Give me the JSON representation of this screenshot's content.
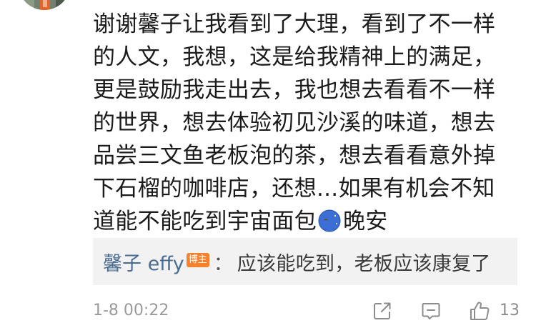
{
  "comment": {
    "lines": [
      "谢谢馨子让我看到了大理，看到了不一样",
      "的人文，我想，这是给我精神上的满足，",
      "更是鼓励我走出去，我也想去看看不一样",
      "的世界，想去体验初见沙溪的味道，想去",
      "品尝三文鱼老板泡的茶，想去看看意外掉",
      "下石榴的咖啡店，还想...如果有机会不知"
    ],
    "last_line_before_emoji": "道能不能吃到宇宙面包",
    "emoji_icon": "crescent-moon-face-icon",
    "last_line_after_emoji": "晚安"
  },
  "reply": {
    "author": "馨子 effy",
    "badge": "博主",
    "colon": "：",
    "text": "应该能吃到，老板应该康复了"
  },
  "meta": {
    "timestamp": "1-8 00:22",
    "like_count": "13"
  },
  "icons": {
    "share": "share-icon",
    "reply": "comment-icon",
    "like": "thumbs-up-icon"
  },
  "colors": {
    "author_link": "#4a6c91",
    "badge": "#f5812c",
    "reply_background": "#f2f2f2",
    "muted_text": "#9a9a9a"
  }
}
